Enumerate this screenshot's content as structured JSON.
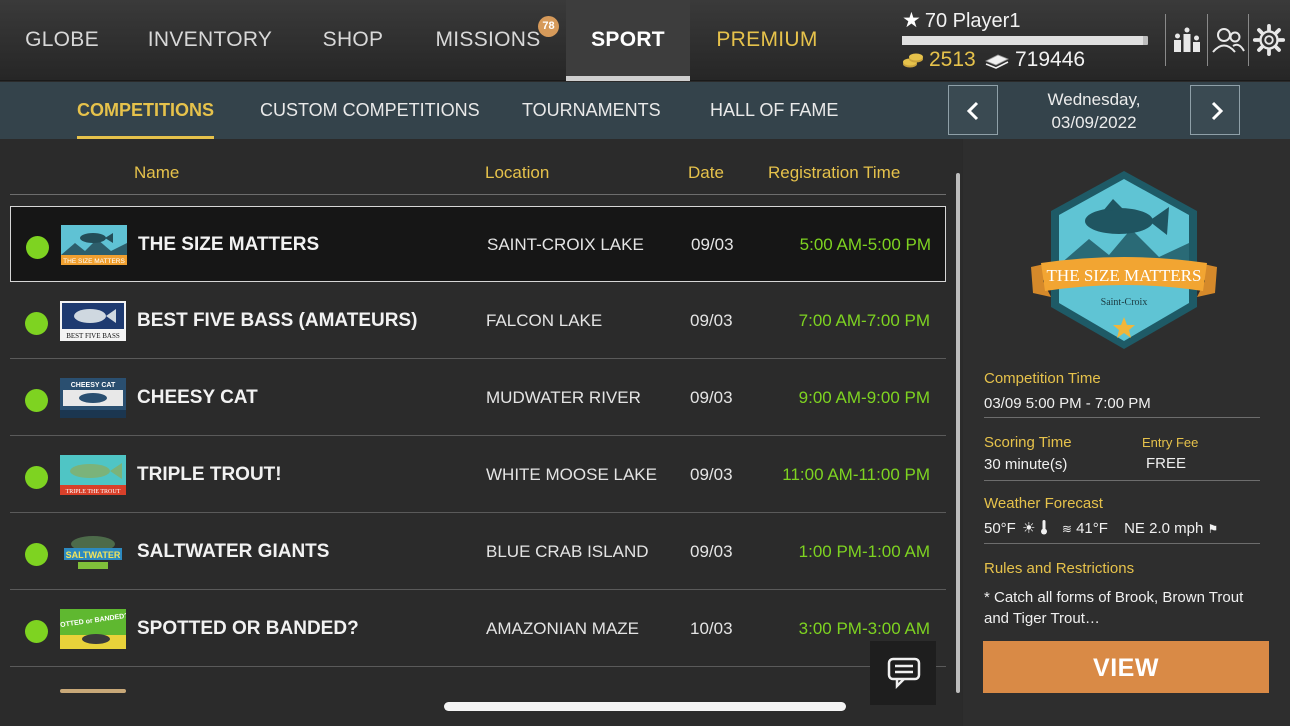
{
  "nav": {
    "items": [
      {
        "label": "GLOBE"
      },
      {
        "label": "INVENTORY"
      },
      {
        "label": "SHOP"
      },
      {
        "label": "MISSIONS",
        "badge": "78"
      },
      {
        "label": "SPORT",
        "active": true
      },
      {
        "label": "PREMIUM"
      }
    ]
  },
  "player": {
    "level": "70",
    "name": "Player1",
    "xp_fraction": 0.98,
    "coins": "2513",
    "bucks": "719446"
  },
  "icons": {
    "leaderboard": "leaderboard-icon",
    "friends": "friends-icon",
    "settings": "gear-icon"
  },
  "subnav": {
    "tabs": [
      {
        "label": "COMPETITIONS",
        "active": true
      },
      {
        "label": "CUSTOM COMPETITIONS"
      },
      {
        "label": "TOURNAMENTS"
      },
      {
        "label": "HALL OF FAME"
      }
    ],
    "date_weekday": "Wednesday,",
    "date_full": "03/09/2022"
  },
  "table": {
    "headers": {
      "name": "Name",
      "location": "Location",
      "date": "Date",
      "time": "Registration Time"
    },
    "rows": [
      {
        "name": "THE SIZE MATTERS",
        "location": "SAINT-CROIX LAKE",
        "date": "09/03",
        "time": "5:00 AM-5:00 PM",
        "logo_text": "THE SIZE MATTERS"
      },
      {
        "name": "BEST FIVE BASS (AMATEURS)",
        "location": "FALCON LAKE",
        "date": "09/03",
        "time": "7:00 AM-7:00 PM",
        "logo_text": "BEST FIVE BASS"
      },
      {
        "name": "CHEESY CAT",
        "location": "MUDWATER RIVER",
        "date": "09/03",
        "time": "9:00 AM-9:00 PM",
        "logo_text": "CHEESY CAT"
      },
      {
        "name": "TRIPLE TROUT!",
        "location": "WHITE MOOSE LAKE",
        "date": "09/03",
        "time": "11:00 AM-11:00 PM",
        "logo_text": "TRIPLE THE TROUT"
      },
      {
        "name": "SALTWATER GIANTS",
        "location": "BLUE CRAB ISLAND",
        "date": "09/03",
        "time": "1:00 PM-1:00 AM",
        "logo_text": "SALTWATER"
      },
      {
        "name": "SPOTTED OR BANDED?",
        "location": "AMAZONIAN MAZE",
        "date": "10/03",
        "time": "3:00 PM-3:00 AM",
        "logo_text": "SPOTTED or BANDED?"
      }
    ]
  },
  "colors": {
    "accent": "#e6c24b",
    "status_green": "#7ed321",
    "view_button": "#d98a46",
    "subnav_bg": "#34434b"
  },
  "detail": {
    "emblem_title": "THE SIZE MATTERS",
    "emblem_location": "Saint-Croix",
    "competition_time_label": "Competition Time",
    "competition_time": "03/09 5:00 PM - 7:00 PM",
    "scoring_time_label": "Scoring Time",
    "scoring_time": "30 minute(s)",
    "entry_fee_label": "Entry Fee",
    "entry_fee": "FREE",
    "weather_label": "Weather Forecast",
    "air_temp": "50°F",
    "water_temp": "41°F",
    "wind": "NE 2.0 mph",
    "rules_label": "Rules and Restrictions",
    "rules_line1": "* Catch all forms of Brook, Brown Trout",
    "rules_line2": "and Tiger Trout…",
    "view_label": "VIEW"
  }
}
